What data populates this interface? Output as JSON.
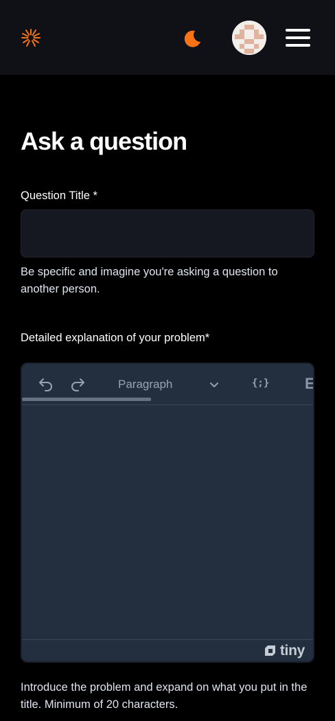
{
  "header": {
    "logo_icon": "sunburst-logo-icon",
    "theme_icon": "moon-icon",
    "avatar_icon": "pixel-avatar",
    "menu_icon": "hamburger-menu-icon",
    "accent": "#f97316"
  },
  "page": {
    "title": "Ask a question"
  },
  "question_title": {
    "label": "Question Title *",
    "value": "",
    "helper": "Be specific and imagine you're asking a question to another person."
  },
  "explanation": {
    "label": "Detailed explanation of your problem*",
    "editor": {
      "block_format": "Paragraph",
      "undo_icon": "undo-icon",
      "redo_icon": "redo-icon",
      "code_icon": "{;}",
      "overflow_label": "E",
      "brand": "tiny"
    },
    "helper": "Introduce the problem and expand on what you put in the title. Minimum of 20 characters."
  }
}
